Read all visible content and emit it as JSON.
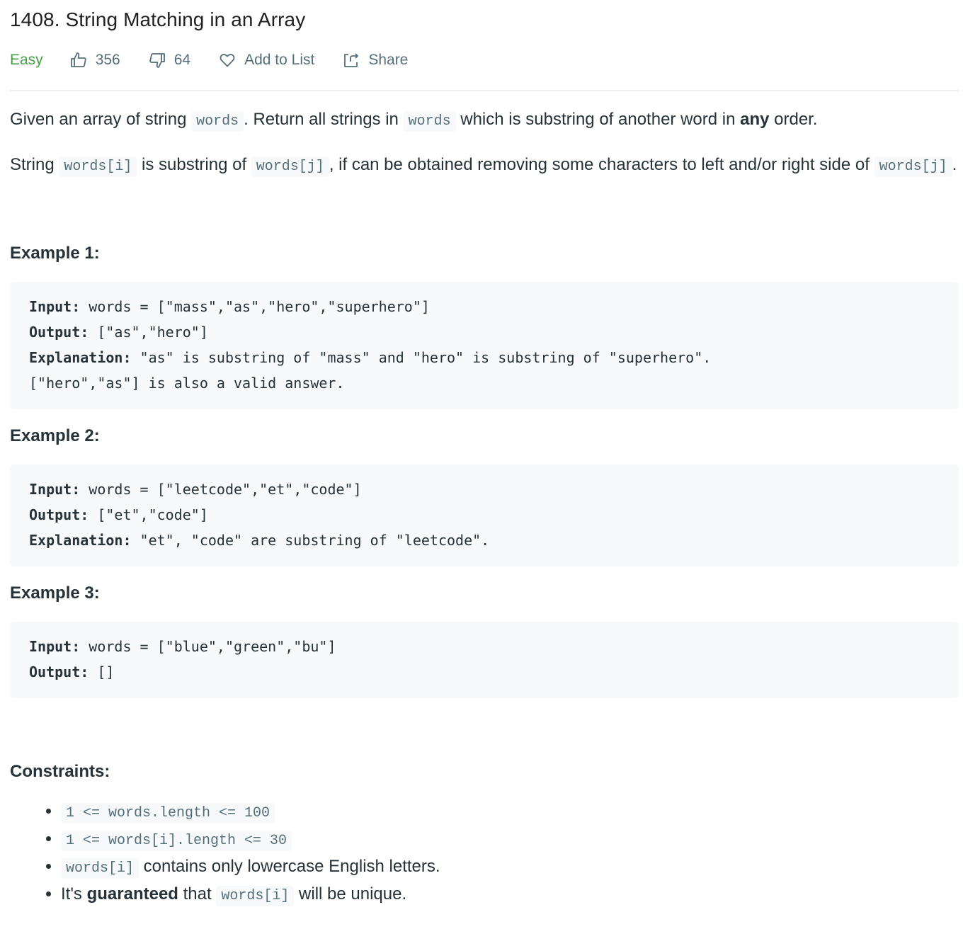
{
  "problem": {
    "title": "1408. String Matching in an Array",
    "difficulty": "Easy",
    "likes": "356",
    "dislikes": "64",
    "add_to_list_label": "Add to List",
    "share_label": "Share"
  },
  "colors": {
    "difficulty_easy": "#43a047",
    "meta_text": "#546e7a",
    "code_bg": "#f7f9fa"
  },
  "description": {
    "p1": {
      "t1": "Given an array of string ",
      "c1": "words",
      "t2": ". Return all strings in ",
      "c2": "words",
      "t3": " which is substring of another word in ",
      "b1": "any",
      "t4": " order."
    },
    "p2": {
      "t1": "String ",
      "c1": "words[i]",
      "t2": " is substring of ",
      "c2": "words[j]",
      "t3": ", if can be obtained removing some characters to left and/or right side of ",
      "c3": "words[j]",
      "t4": "."
    }
  },
  "examples": [
    {
      "title": "Example 1:",
      "input_label": "Input:",
      "input": " words = [\"mass\",\"as\",\"hero\",\"superhero\"]",
      "output_label": "Output:",
      "output": " [\"as\",\"hero\"]",
      "explanation_label": "Explanation:",
      "explanation": " \"as\" is substring of \"mass\" and \"hero\" is substring of \"superhero\".",
      "extra": "[\"hero\",\"as\"] is also a valid answer."
    },
    {
      "title": "Example 2:",
      "input_label": "Input:",
      "input": " words = [\"leetcode\",\"et\",\"code\"]",
      "output_label": "Output:",
      "output": " [\"et\",\"code\"]",
      "explanation_label": "Explanation:",
      "explanation": " \"et\", \"code\" are substring of \"leetcode\"."
    },
    {
      "title": "Example 3:",
      "input_label": "Input:",
      "input": " words = [\"blue\",\"green\",\"bu\"]",
      "output_label": "Output:",
      "output": " []"
    }
  ],
  "constraints": {
    "title": "Constraints:",
    "items": [
      {
        "code": "1 <= words.length <= 100"
      },
      {
        "code": "1 <= words[i].length <= 30"
      },
      {
        "code": "words[i]",
        "text": " contains only lowercase English letters."
      },
      {
        "t1": "It's ",
        "bold": "guaranteed",
        "t2": " that ",
        "code": "words[i]",
        "t3": " will be unique."
      }
    ]
  },
  "icons": {
    "like": "thumbs-up-icon",
    "dislike": "thumbs-down-icon",
    "add_to_list": "heart-icon",
    "share": "share-icon"
  }
}
